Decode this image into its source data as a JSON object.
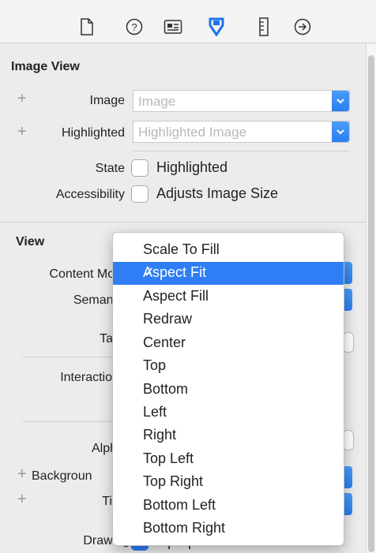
{
  "toolbar": {
    "icons": [
      "file-inspector-icon",
      "quick-help-icon",
      "identity-inspector-icon",
      "attributes-inspector-icon",
      "size-inspector-icon",
      "connections-inspector-icon"
    ]
  },
  "image_view": {
    "title": "Image View",
    "image_label": "Image",
    "image_placeholder": "Image",
    "highlighted_label": "Highlighted",
    "highlighted_placeholder": "Highlighted Image",
    "state_label": "State",
    "state_checkbox": "Highlighted",
    "accessibility_label": "Accessibility",
    "accessibility_checkbox": "Adjusts Image Size"
  },
  "view": {
    "title": "View",
    "content_mode_label": "Content Mod",
    "semantic_label": "Semant",
    "tag_label": "Ta",
    "interaction_label": "Interactio",
    "alpha_label": "Alph",
    "background_label": "Backgroun",
    "tint_label": "Ti",
    "drawing_label": "Drawing",
    "drawing_value": "Opaque"
  },
  "menu": {
    "items": [
      "Scale To Fill",
      "Aspect Fit",
      "Aspect Fill",
      "Redraw",
      "Center",
      "Top",
      "Bottom",
      "Left",
      "Right",
      "Top Left",
      "Top Right",
      "Bottom Left",
      "Bottom Right"
    ],
    "selected": "Aspect Fit",
    "check": "✓"
  },
  "colors": {
    "accent": "#2f7ef5"
  }
}
